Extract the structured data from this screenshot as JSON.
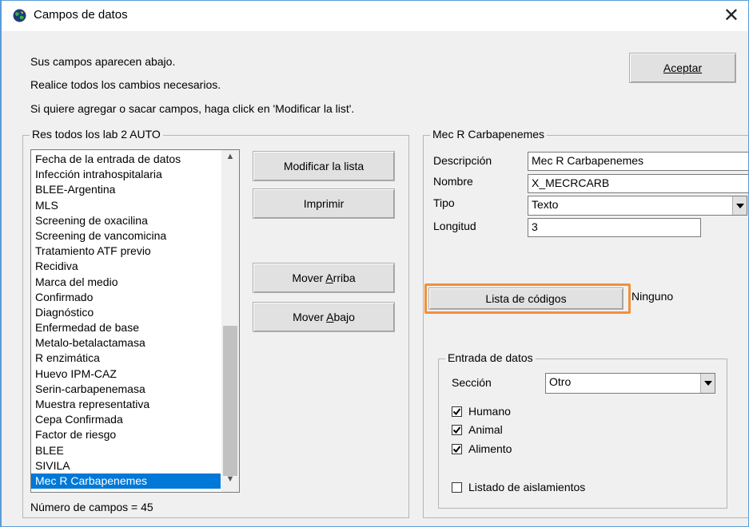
{
  "window": {
    "title": "Campos de datos",
    "close_glyph": "✕",
    "app_icon": "globe-icon"
  },
  "info": {
    "line1": "Sus campos aparecen abajo.",
    "line2": "Realice todos los cambios necesarios.",
    "line3": "Si quiere agregar o sacar campos, haga click en 'Modificar la list'."
  },
  "buttons": {
    "accept": "Aceptar",
    "modify_list": "Modificar la lista",
    "print": "Imprimir",
    "move_up_prefix": "Mover ",
    "move_up_key": "A",
    "move_up_rest": "rriba",
    "move_down_prefix": "Mover ",
    "move_down_key": "A",
    "move_down_rest": "bajo",
    "code_list": "Lista de códigos"
  },
  "fields_group": {
    "label": "Res todos los lab 2 AUTO",
    "items": [
      "Fecha de la entrada de datos",
      "Infección intrahospitalaria",
      "BLEE-Argentina",
      "MLS",
      "Screening de oxacilina",
      "Screening de vancomicina",
      "Tratamiento ATF previo",
      "Recidiva",
      "Marca del medio",
      "Confirmado",
      "Diagnóstico",
      "Enfermedad de base",
      "Metalo-betalactamasa",
      "R enzimática",
      "Huevo IPM-CAZ",
      "Serin-carbapenemasa",
      "Muestra representativa",
      "Cepa Confirmada",
      "Factor de riesgo",
      "BLEE",
      "SIVILA",
      "Mec R Carbapenemes"
    ],
    "selected": "Mec R Carbapenemes",
    "count_text": "Número de campos = 45"
  },
  "details_group": {
    "label": "Mec R Carbapenemes",
    "description_label": "Descripción",
    "description_value": "Mec R Carbapenemes",
    "name_label": "Nombre",
    "name_value": "X_MECRCARB",
    "type_label": "Tipo",
    "type_value": "Texto",
    "length_label": "Longitud",
    "length_value": "3",
    "code_list_status": "Ninguno"
  },
  "data_entry_group": {
    "label": "Entrada de datos",
    "section_label": "Sección",
    "section_value": "Otro",
    "human_label": "Humano",
    "human_checked": true,
    "animal_label": "Animal",
    "animal_checked": true,
    "food_label": "Alimento",
    "food_checked": true,
    "isolates_label": "Listado de aislamientos",
    "isolates_checked": false
  },
  "colors": {
    "highlight": "#f0913a",
    "selection": "#0078d7",
    "window_border": "#5b9bd5"
  }
}
